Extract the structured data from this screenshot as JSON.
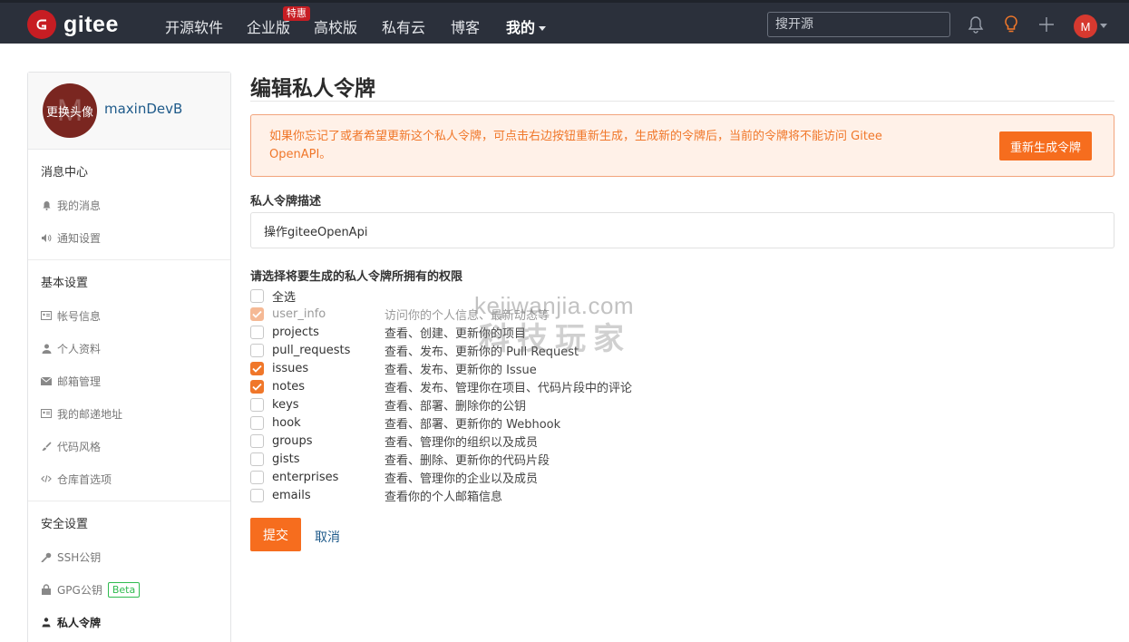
{
  "brand": {
    "name": "gitee"
  },
  "nav": {
    "items": [
      "开源软件",
      "企业版",
      "高校版",
      "私有云",
      "博客",
      "我的"
    ],
    "hot_badge": "特惠",
    "search_placeholder": "搜开源"
  },
  "user": {
    "avatar_letter": "M",
    "name": "maxinDevB",
    "avatar_hover": "更换头像"
  },
  "sidebar": {
    "sections": [
      {
        "title": "消息中心",
        "items": [
          {
            "label": "我的消息",
            "icon": "bell-icon"
          },
          {
            "label": "通知设置",
            "icon": "speaker-icon"
          }
        ]
      },
      {
        "title": "基本设置",
        "items": [
          {
            "label": "帐号信息",
            "icon": "id-card-icon"
          },
          {
            "label": "个人资料",
            "icon": "user-icon"
          },
          {
            "label": "邮箱管理",
            "icon": "envelope-icon"
          },
          {
            "label": "我的邮递地址",
            "icon": "id-card-icon"
          },
          {
            "label": "代码风格",
            "icon": "brush-icon"
          },
          {
            "label": "仓库首选项",
            "icon": "code-icon"
          }
        ]
      },
      {
        "title": "安全设置",
        "items": [
          {
            "label": "SSH公钥",
            "icon": "key-icon"
          },
          {
            "label": "GPG公钥",
            "icon": "lock-icon",
            "badge": "Beta"
          },
          {
            "label": "私人令牌",
            "icon": "users-icon",
            "active": true
          }
        ]
      }
    ]
  },
  "main": {
    "title": "编辑私人令牌",
    "warning": "如果你忘记了或者希望更新这个私人令牌，可点击右边按钮重新生成，生成新的令牌后，当前的令牌将不能访问 Gitee OpenAPI。",
    "regen_button": "重新生成令牌",
    "desc_label": "私人令牌描述",
    "desc_value": "操作giteeOpenApi",
    "perm_label": "请选择将要生成的私人令牌所拥有的权限",
    "select_all": "全选",
    "permissions": [
      {
        "name": "user_info",
        "desc": "访问你的个人信息、最新动态等",
        "checked": true,
        "disabled": true
      },
      {
        "name": "projects",
        "desc": "查看、创建、更新你的项目",
        "checked": false
      },
      {
        "name": "pull_requests",
        "desc": "查看、发布、更新你的 Pull Request",
        "checked": false
      },
      {
        "name": "issues",
        "desc": "查看、发布、更新你的 Issue",
        "checked": true
      },
      {
        "name": "notes",
        "desc": "查看、发布、管理你在项目、代码片段中的评论",
        "checked": true
      },
      {
        "name": "keys",
        "desc": "查看、部署、删除你的公钥",
        "checked": false
      },
      {
        "name": "hook",
        "desc": "查看、部署、更新你的 Webhook",
        "checked": false
      },
      {
        "name": "groups",
        "desc": "查看、管理你的组织以及成员",
        "checked": false
      },
      {
        "name": "gists",
        "desc": "查看、删除、更新你的代码片段",
        "checked": false
      },
      {
        "name": "enterprises",
        "desc": "查看、管理你的企业以及成员",
        "checked": false
      },
      {
        "name": "emails",
        "desc": "查看你的个人邮箱信息",
        "checked": false
      }
    ],
    "submit_button": "提交",
    "cancel_link": "取消"
  },
  "watermark": {
    "domain": "kejiwanjia.com",
    "text": "科技玩家"
  },
  "colors": {
    "accent": "#f66d1e",
    "topbar": "#2b303b",
    "brand_red": "#c71d23",
    "link": "#1e5a8a"
  }
}
